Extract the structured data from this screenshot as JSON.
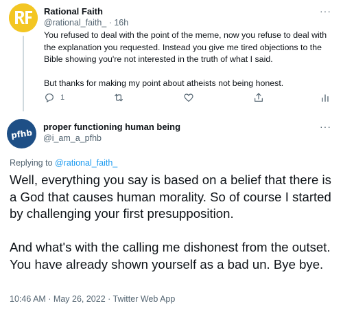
{
  "reply_tweet": {
    "author_name": "Rational Faith",
    "handle": "@rational_faith_",
    "separator": "·",
    "time_ago": "16h",
    "paragraphs": [
      "You refused to deal with the point of the meme, now you refuse to deal with the explanation you requested. Instead you give me tired objections to the Bible showing you're not interested in the truth of what I said.",
      "But thanks for making my point about atheists not being honest."
    ],
    "reply_count": "1",
    "more_label": "···",
    "avatar_icon": "rf-logo-icon",
    "avatar_color": "#f3c623"
  },
  "main_tweet": {
    "author_name": "proper functioning human being",
    "handle": "@i_am_a_pfhb",
    "avatar_text": "pfhb",
    "avatar_color": "#1e4f86",
    "more_label": "···",
    "replying_prefix": "Replying to",
    "replying_to": "@rational_faith_",
    "paragraphs": [
      "Well, everything you say is based on a belief that there is a God that causes human morality. So of course I started by challenging your first presupposition.",
      "And what's with the calling me dishonest from the outset. You have already shown yourself as a bad un. Bye bye."
    ],
    "timestamp": "10:46 AM · May 26, 2022 · Twitter Web App"
  },
  "colors": {
    "text": "#0f1419",
    "secondary": "#536471",
    "link": "#1d9bf0",
    "thread_line": "#cfd9de"
  },
  "icons": [
    "reply-icon",
    "retweet-icon",
    "like-icon",
    "share-icon",
    "analytics-icon"
  ]
}
